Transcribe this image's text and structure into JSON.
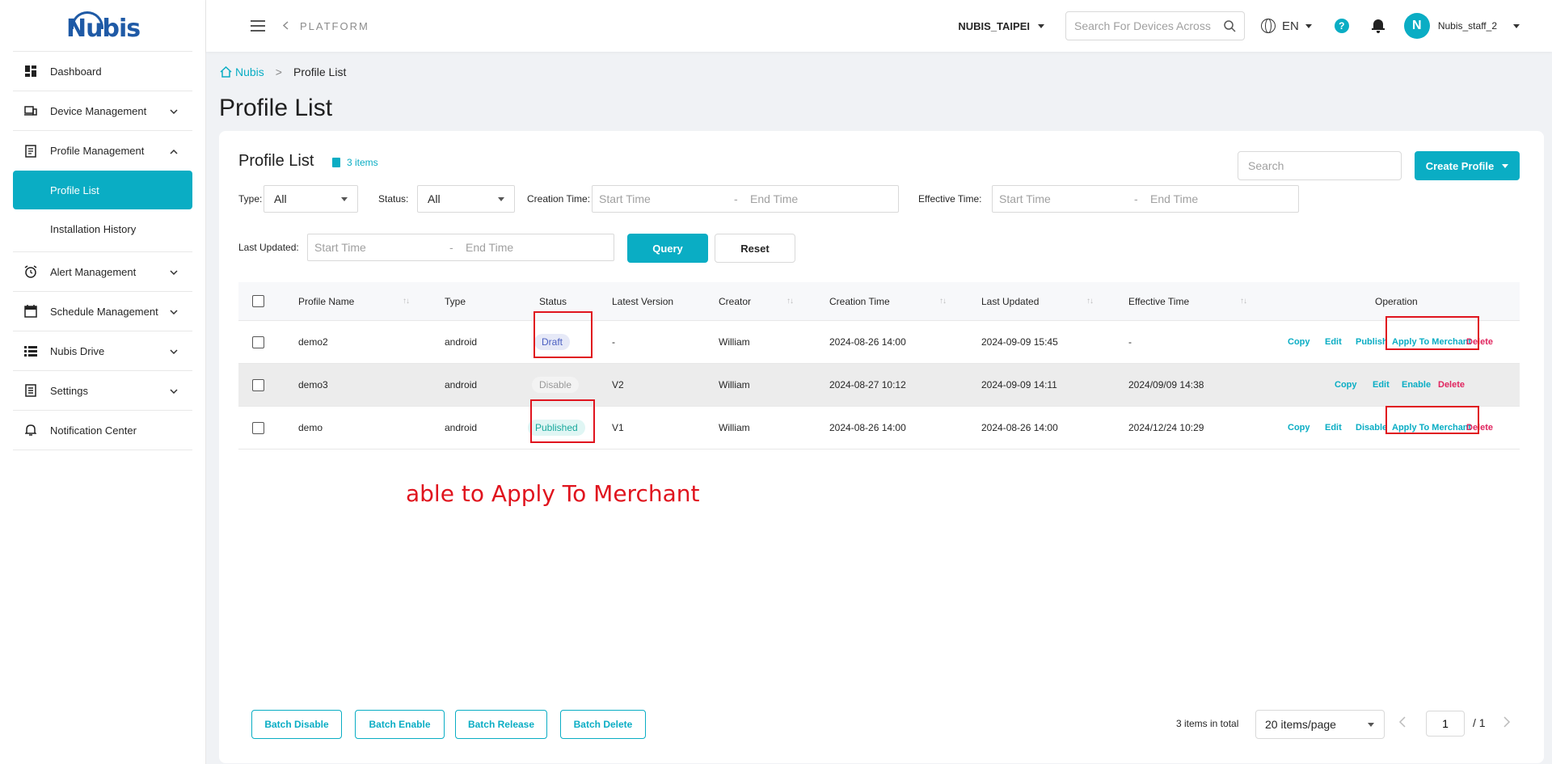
{
  "brand": {
    "logo_text": "Nubis"
  },
  "sidebar": {
    "items": [
      {
        "label": "Dashboard",
        "icon": "dashboard-icon"
      },
      {
        "label": "Device Management",
        "icon": "device-icon"
      },
      {
        "label": "Profile Management",
        "icon": "profile-icon"
      },
      {
        "label": "Alert Management",
        "icon": "alarm-clock-icon"
      },
      {
        "label": "Schedule Management",
        "icon": "calendar-icon"
      },
      {
        "label": "Nubis Drive",
        "icon": "drive-list-icon"
      },
      {
        "label": "Settings",
        "icon": "settings-list-icon"
      },
      {
        "label": "Notification Center",
        "icon": "bell-icon"
      }
    ],
    "sub_items": [
      {
        "label": "Profile List"
      },
      {
        "label": "Installation History"
      }
    ]
  },
  "header": {
    "platform": "PLATFORM",
    "org": "NUBIS_TAIPEI",
    "search_placeholder": "Search For Devices Across",
    "lang": "EN",
    "help": "?",
    "avatar": "N",
    "user": "Nubis_staff_2"
  },
  "breadcrumb": {
    "home": "Nubis",
    "current": "Profile List"
  },
  "page_title": "Profile List",
  "card": {
    "title": "Profile List",
    "count": "3 items",
    "search_placeholder": "Search",
    "create_label": "Create Profile"
  },
  "filters": {
    "type_label": "Type:",
    "type_value": "All",
    "status_label": "Status:",
    "status_value": "All",
    "creation_label": "Creation Time:",
    "effective_label": "Effective Time:",
    "updated_label": "Last Updated:",
    "start_placeholder": "Start Time",
    "end_placeholder": "End Time",
    "dash": "-",
    "query": "Query",
    "reset": "Reset"
  },
  "table": {
    "headers": {
      "name": "Profile Name",
      "type": "Type",
      "status": "Status",
      "version": "Latest Version",
      "creator": "Creator",
      "created": "Creation Time",
      "updated": "Last Updated",
      "effective": "Effective Time",
      "operation": "Operation"
    },
    "sort_glyph": "↑↓",
    "rows": [
      {
        "name": "demo2",
        "type": "android",
        "status": "Draft",
        "version": "-",
        "creator": "William",
        "created": "2024-08-26 14:00",
        "updated": "2024-09-09 15:45",
        "effective": "-",
        "ops": [
          "Copy",
          "Edit",
          "Publish",
          "Apply To Merchant",
          "Delete"
        ]
      },
      {
        "name": "demo3",
        "type": "android",
        "status": "Disable",
        "version": "V2",
        "creator": "William",
        "created": "2024-08-27 10:12",
        "updated": "2024-09-09 14:11",
        "effective": "2024/09/09 14:38",
        "ops": [
          "Copy",
          "Edit",
          "Enable",
          "Delete"
        ]
      },
      {
        "name": "demo",
        "type": "android",
        "status": "Published",
        "version": "V1",
        "creator": "William",
        "created": "2024-08-26 14:00",
        "updated": "2024-08-26 14:00",
        "effective": "2024/12/24 10:29",
        "ops": [
          "Copy",
          "Edit",
          "Disable",
          "Apply To Merchant",
          "Delete"
        ]
      }
    ]
  },
  "annotation": "able to Apply To Merchant",
  "footer": {
    "batch_disable": "Batch Disable",
    "batch_enable": "Batch Enable",
    "batch_release": "Batch Release",
    "batch_delete": "Batch Delete",
    "total": "3 items in total",
    "page_size": "20 items/page",
    "page": "1",
    "page_total": "/ 1"
  },
  "colors": {
    "accent": "#0aadc4",
    "delete": "#e0245e",
    "annotation": "#e0141e"
  }
}
